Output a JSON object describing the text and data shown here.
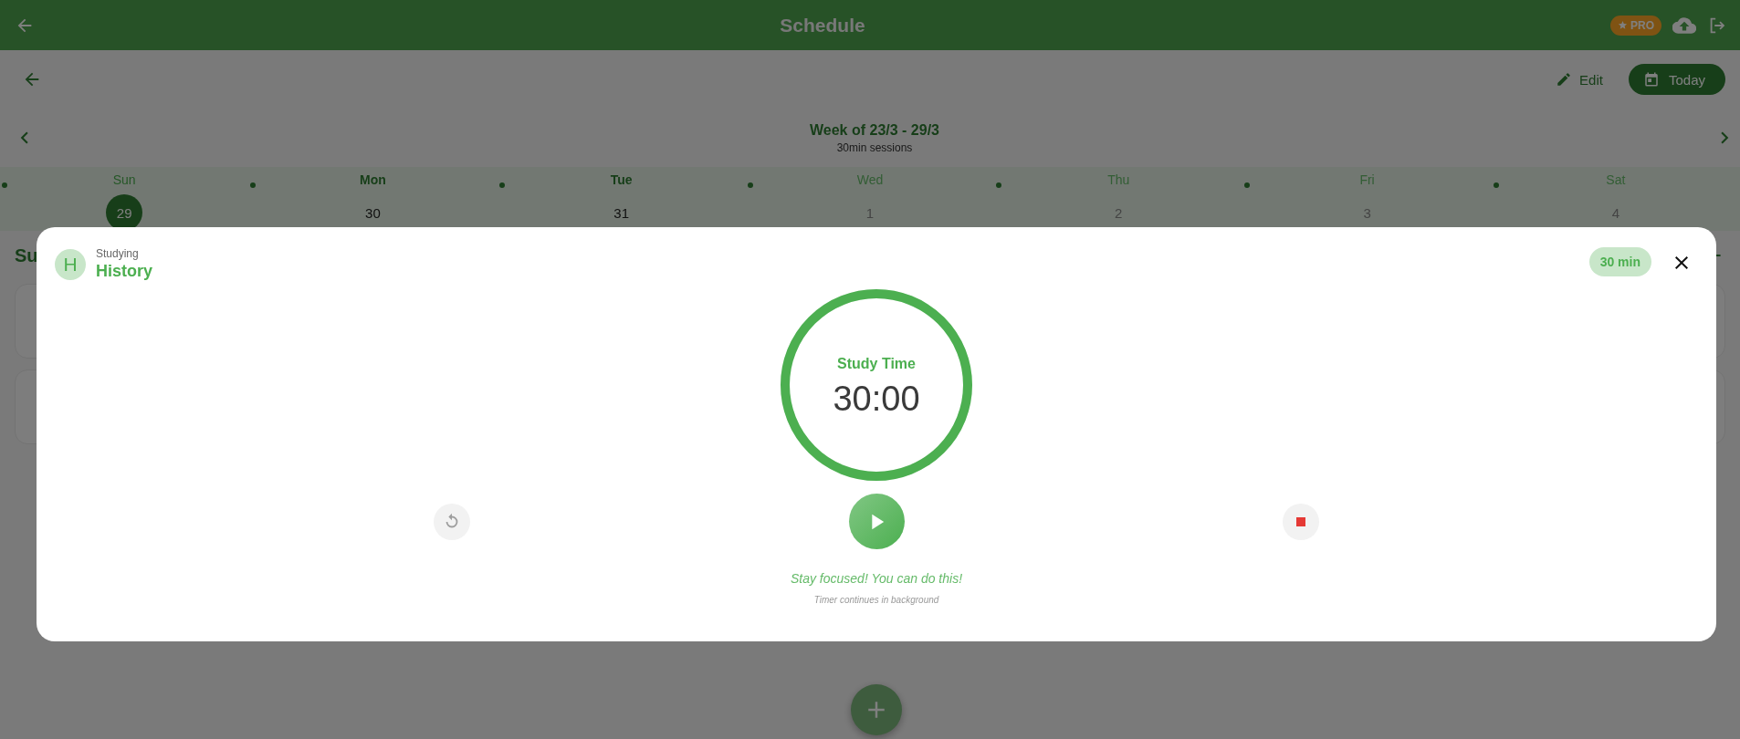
{
  "app_bar": {
    "title": "Schedule",
    "pro_badge": "PRO"
  },
  "toolbar": {
    "edit": "Edit",
    "today": "Today"
  },
  "week": {
    "title": "Week of 23/3 - 29/3",
    "subtitle": "30min sessions"
  },
  "days": [
    {
      "name": "Sun",
      "date": "29",
      "selected": true,
      "muted": false
    },
    {
      "name": "Mon",
      "date": "30",
      "selected": false,
      "muted": false
    },
    {
      "name": "Tue",
      "date": "31",
      "selected": false,
      "muted": false
    },
    {
      "name": "Wed",
      "date": "1",
      "selected": false,
      "muted": true
    },
    {
      "name": "Thu",
      "date": "2",
      "selected": false,
      "muted": true
    },
    {
      "name": "Fri",
      "date": "3",
      "selected": false,
      "muted": true
    },
    {
      "name": "Sat",
      "date": "4",
      "selected": false,
      "muted": true
    }
  ],
  "section_heading": "Su",
  "session": {
    "avatar": "H",
    "status": "Studying",
    "subject": "History",
    "duration": "30 min",
    "label": "Study Time",
    "time": "30:00",
    "level": 1,
    "message": "Stay focused! You can do this!",
    "note": "Timer continues in background"
  }
}
